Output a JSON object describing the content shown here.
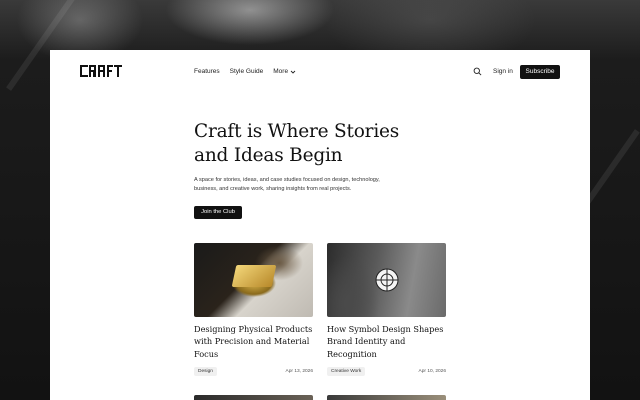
{
  "nav": {
    "logo_icon": "craft-wordmark-logo",
    "logo_text": "CRAFT",
    "links": [
      "Features",
      "Style Guide"
    ],
    "more_label": "More",
    "search_icon": "search-icon",
    "signin_label": "Sign in",
    "subscribe_label": "Subscribe"
  },
  "hero": {
    "title_line1": "Craft is Where Stories",
    "title_line2": "and Ideas Begin",
    "subtitle_line1": "A space for stories, ideas, and case studies focused on design, technology,",
    "subtitle_line2": "business, and creative work, sharing insights from real projects.",
    "cta_label": "Join the Club"
  },
  "articles": [
    {
      "title": "Designing Physical Products with Precision and Material Focus",
      "tag": "Design",
      "date": "Apr 13, 2026"
    },
    {
      "title": "How Symbol Design Shapes Brand Identity and Recognition",
      "tag": "Creative Work",
      "date": "Apr 10, 2026"
    }
  ],
  "colors": {
    "primary": "#111111",
    "background": "#ffffff",
    "page_backdrop": "#141414",
    "tag_bg": "#f0f0f0"
  }
}
